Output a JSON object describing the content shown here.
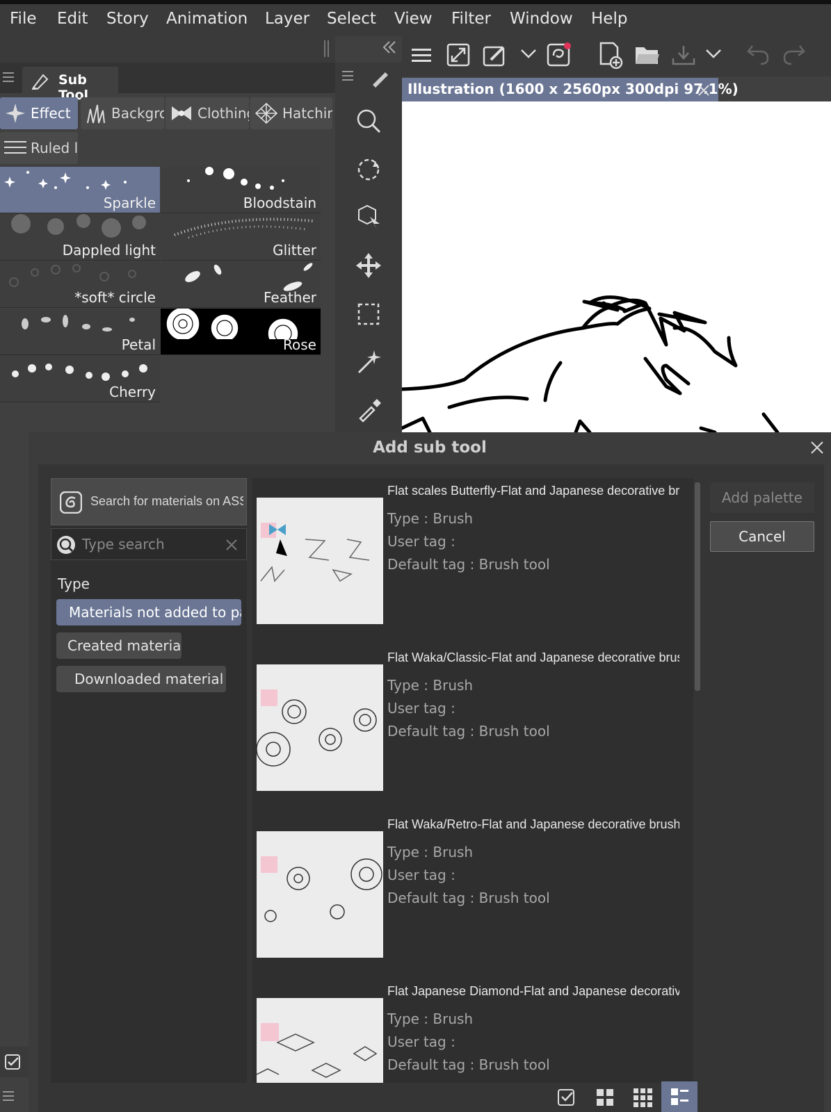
{
  "menu": [
    "File",
    "Edit",
    "Story",
    "Animation",
    "Layer",
    "Select",
    "View",
    "Filter",
    "Window",
    "Help"
  ],
  "subtool": {
    "title": "Sub Tool",
    "tabs": [
      {
        "label": "Effect",
        "icon": "sparkle-icon"
      },
      {
        "label": "Backgro",
        "icon": "grass-icon"
      },
      {
        "label": "Clothing",
        "icon": "bow-icon"
      },
      {
        "label": "Hatchin",
        "icon": "hatching-icon"
      },
      {
        "label": "Ruled li",
        "icon": "ruled-lines-icon"
      }
    ],
    "brushes": [
      "Sparkle",
      "Bloodstain",
      "Dappled light",
      "Glitter",
      "*soft* circle",
      "Feather",
      "Petal",
      "Rose",
      "Cherry"
    ]
  },
  "tools": [
    "zoom-icon",
    "rotate-icon",
    "object-select-icon",
    "move-icon",
    "selection-icon",
    "auto-select-icon",
    "eyedropper-icon"
  ],
  "document": {
    "tab_label": "Illustration (1600 x 2560px 300dpi 97.1%)"
  },
  "dialog": {
    "title": "Add sub tool",
    "assets_button": "Search for materials on ASSETS",
    "search_placeholder": "Type search",
    "type_heading": "Type",
    "type_options": [
      "Materials not added to palette",
      "Created material",
      "Downloaded material"
    ],
    "add_palette": "Add palette",
    "cancel": "Cancel",
    "items": [
      {
        "title": "Flat scales Butterfly-Flat and Japanese decorative brushes",
        "type": "Type : Brush",
        "user_tag": "User tag :",
        "default_tag": "Default tag : Brush tool"
      },
      {
        "title": "Flat Waka/Classic-Flat and Japanese decorative brushes",
        "type": "Type : Brush",
        "user_tag": "User tag :",
        "default_tag": "Default tag : Brush tool"
      },
      {
        "title": "Flat Waka/Retro-Flat and Japanese decorative brushes",
        "type": "Type : Brush",
        "user_tag": "User tag :",
        "default_tag": "Default tag : Brush tool"
      },
      {
        "title": "Flat Japanese Diamond-Flat and Japanese decorative brushes",
        "type": "Type : Brush",
        "user_tag": "User tag :",
        "default_tag": "Default tag : Brush tool"
      }
    ]
  },
  "colors": {
    "accent": "#6a7694",
    "panel": "#404040",
    "dark": "#2f2f2f"
  }
}
